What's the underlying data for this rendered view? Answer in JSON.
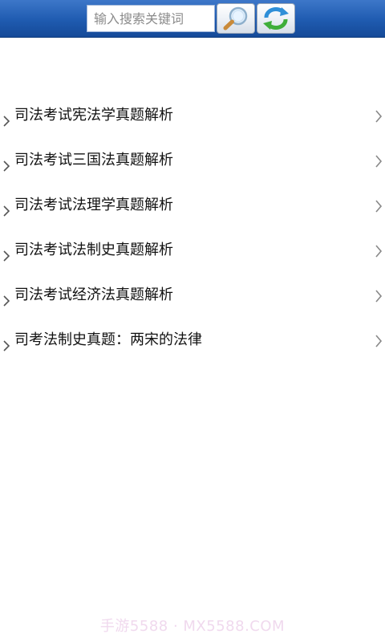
{
  "search": {
    "placeholder": "输入搜索关键词",
    "value": ""
  },
  "toolbar": {
    "search_icon": "magnifier-icon",
    "refresh_icon": "refresh-icon"
  },
  "list": {
    "items": [
      {
        "label": "司法考试宪法学真题解析"
      },
      {
        "label": "司法考试三国法真题解析"
      },
      {
        "label": "司法考试法理学真题解析"
      },
      {
        "label": "司法考试法制史真题解析"
      },
      {
        "label": "司法考试经济法真题解析"
      },
      {
        "label": "司考法制史真题：两宋的法律"
      }
    ]
  },
  "watermark": {
    "text": "手游5588 · MX5588.COM"
  },
  "colors": {
    "topbar": "#1f5bb0",
    "text": "#111111",
    "chevron": "#888888"
  }
}
